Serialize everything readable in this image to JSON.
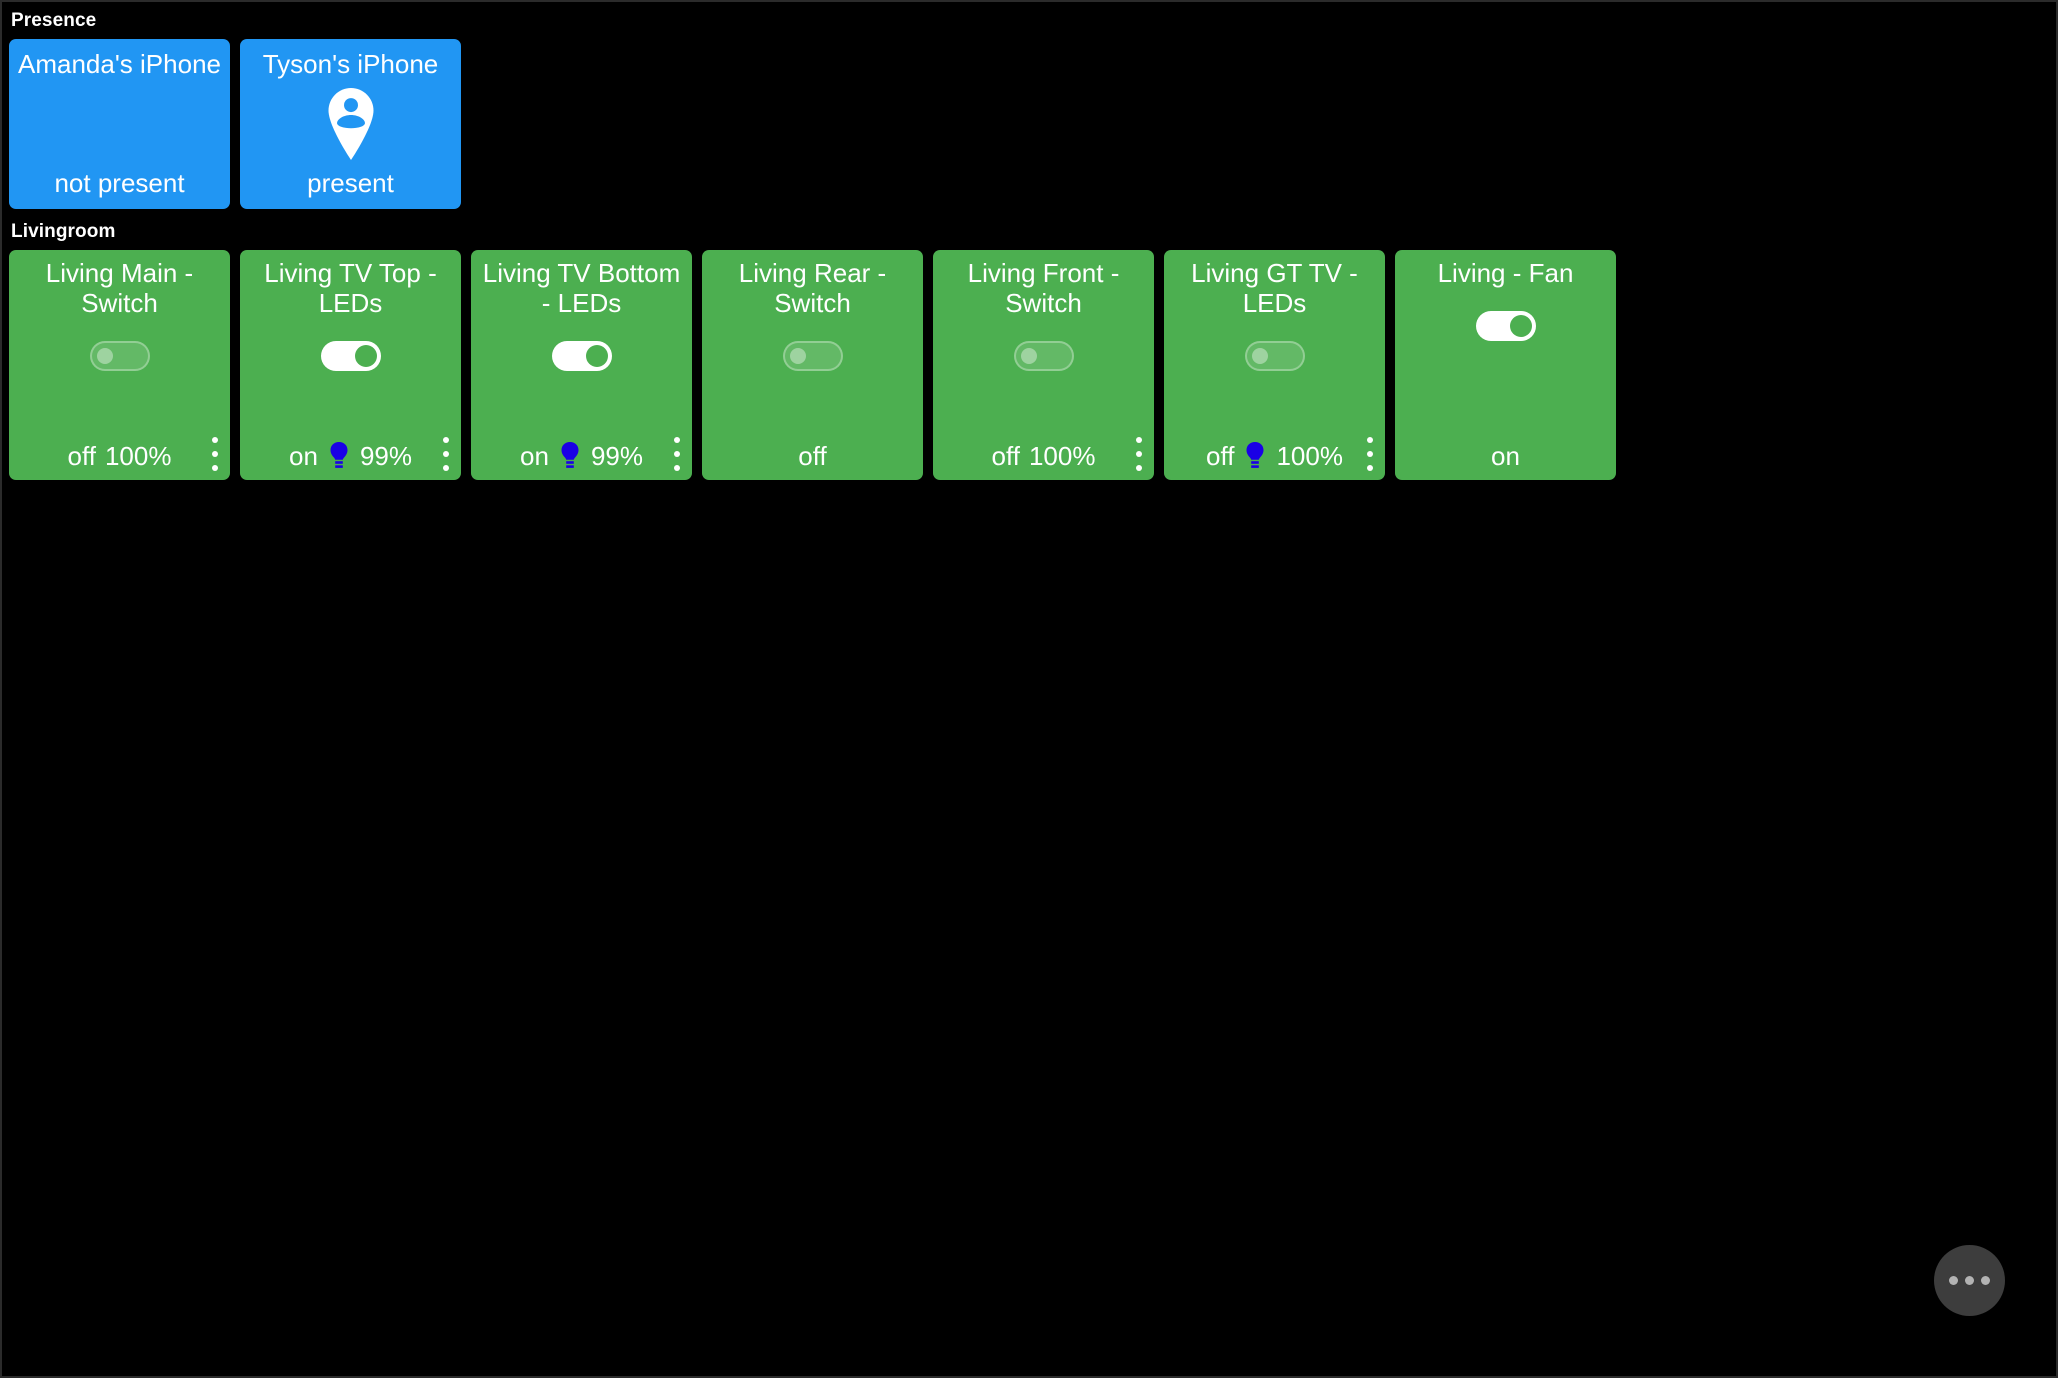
{
  "background_color": "#000000",
  "colors": {
    "presence_card": "#2196F3",
    "device_card": "#4CAF50",
    "bulb": "#1A00E6",
    "fab": "#3D3D3D",
    "fab_dot": "#B3B3B3",
    "text": "#FFFFFF"
  },
  "sections": {
    "presence": {
      "label": "Presence",
      "cards": [
        {
          "name": "Amanda's iPhone",
          "state": "not present",
          "icon": "",
          "has_icon": false
        },
        {
          "name": "Tyson's iPhone",
          "state": "present",
          "icon": "person-pin-icon",
          "has_icon": true
        }
      ]
    },
    "livingroom": {
      "label": "Livingroom",
      "cards": [
        {
          "name": "Living Main - Switch",
          "toggle": "off",
          "state": "off",
          "level": "100%",
          "has_bulb": false,
          "has_menu": true
        },
        {
          "name": "Living TV Top - LEDs",
          "toggle": "on",
          "state": "on",
          "level": "99%",
          "has_bulb": true,
          "has_menu": true
        },
        {
          "name": "Living TV Bottom - LEDs",
          "toggle": "on",
          "state": "on",
          "level": "99%",
          "has_bulb": true,
          "has_menu": true
        },
        {
          "name": "Living Rear - Switch",
          "toggle": "off",
          "state": "off",
          "level": "",
          "has_bulb": false,
          "has_menu": false
        },
        {
          "name": "Living Front - Switch",
          "toggle": "off",
          "state": "off",
          "level": "100%",
          "has_bulb": false,
          "has_menu": true
        },
        {
          "name": "Living GT TV - LEDs",
          "toggle": "off",
          "state": "off",
          "level": "100%",
          "has_bulb": true,
          "has_menu": true
        },
        {
          "name": "Living - Fan",
          "toggle": "on",
          "state": "on",
          "level": "",
          "has_bulb": false,
          "has_menu": false
        }
      ]
    }
  },
  "fab": {
    "icon": "more-horizontal-icon"
  }
}
